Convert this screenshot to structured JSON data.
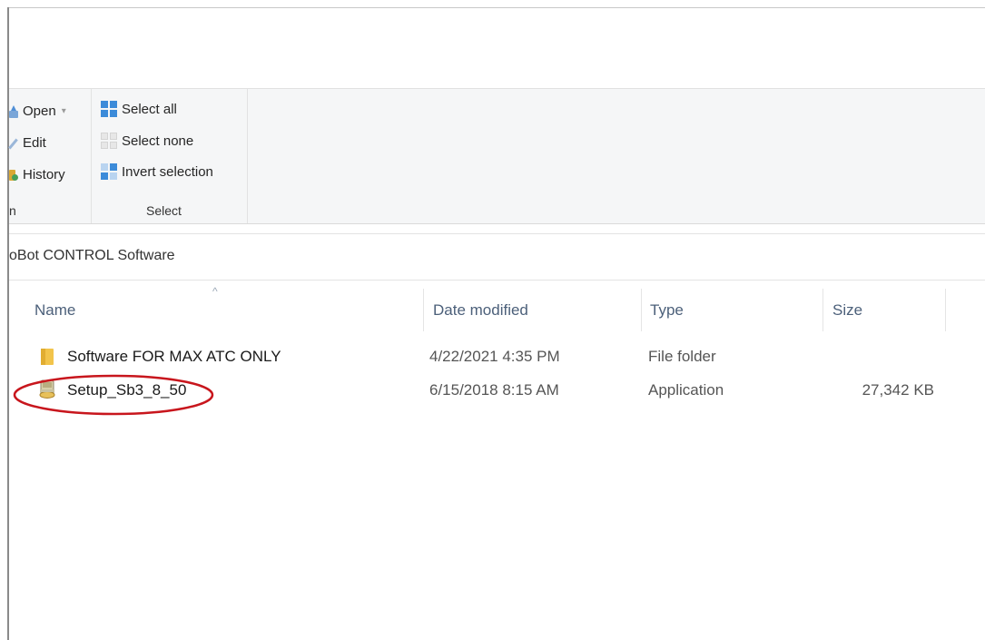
{
  "ribbon": {
    "open_group": {
      "items": [
        {
          "label": "Open",
          "icon": "open-icon",
          "has_dropdown": true
        },
        {
          "label": "Edit",
          "icon": "edit-icon"
        },
        {
          "label": "History",
          "icon": "history-icon"
        }
      ],
      "group_label": "n"
    },
    "select_group": {
      "items": [
        {
          "label": "Select all",
          "icon": "select-all-icon"
        },
        {
          "label": "Select none",
          "icon": "select-none-icon"
        },
        {
          "label": "Invert selection",
          "icon": "invert-selection-icon"
        }
      ],
      "group_label": "Select"
    },
    "dropdown_glyph": "▾"
  },
  "address": {
    "path": "oBot CONTROL Software"
  },
  "file_list": {
    "sort_glyph": "^",
    "columns": [
      "Name",
      "Date modified",
      "Type",
      "Size"
    ],
    "rows": [
      {
        "name": "Software FOR MAX ATC ONLY",
        "date": "4/22/2021 4:35 PM",
        "type": "File folder",
        "size": "",
        "icon": "folder-icon"
      },
      {
        "name": "Setup_Sb3_8_50",
        "date": "6/15/2018 8:15 AM",
        "type": "Application",
        "size": "27,342 KB",
        "icon": "installer-icon",
        "highlighted": true
      }
    ]
  },
  "colors": {
    "highlight": "#c8161d",
    "header_text": "#4c607a",
    "accent": "#3c8bd9"
  }
}
